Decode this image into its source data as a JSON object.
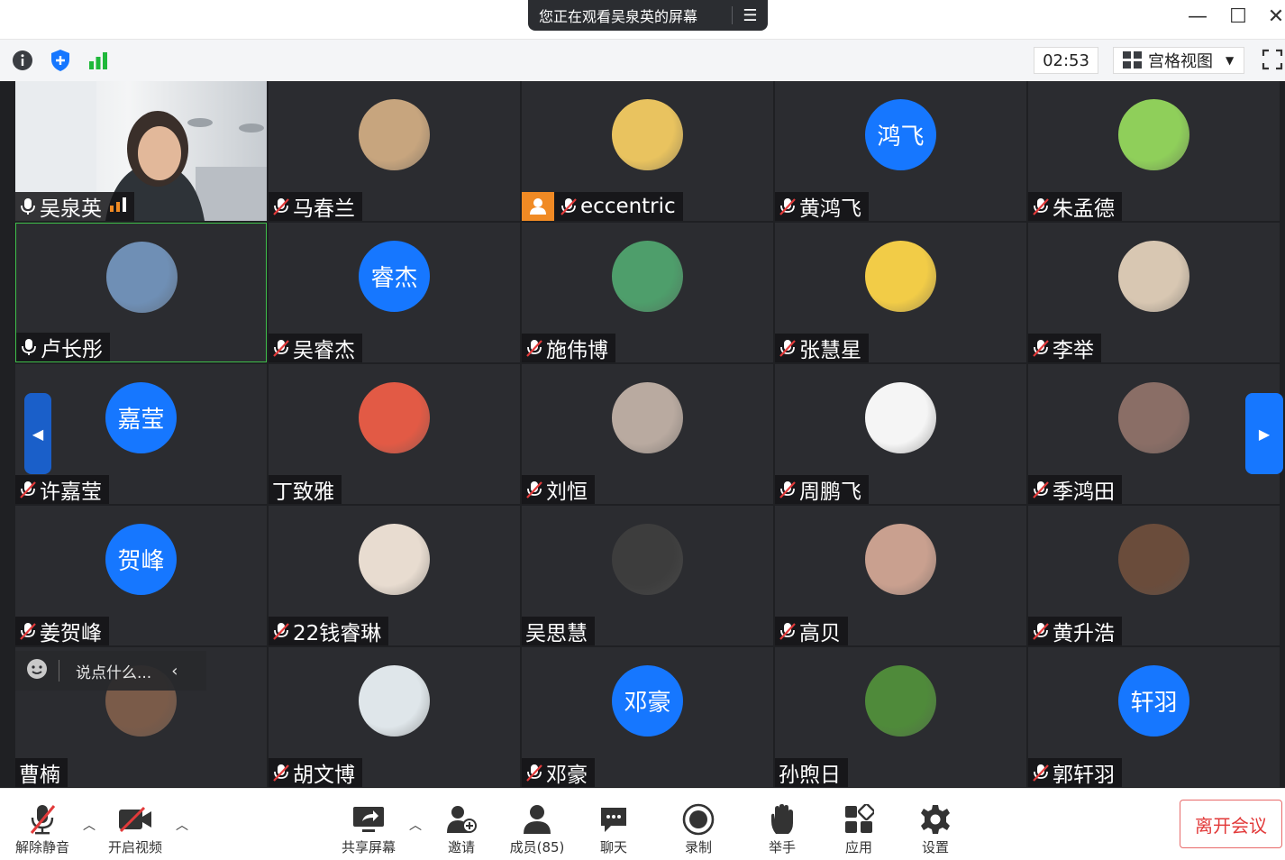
{
  "banner": {
    "text": "您正在观看吴泉英的屏幕",
    "menu_icon": "list-icon"
  },
  "window": {
    "minimize": "—",
    "maximize": "☐",
    "close": "✕"
  },
  "infobar": {
    "timer": "02:53",
    "view_mode": "宫格视图"
  },
  "chat": {
    "placeholder": "说点什么..."
  },
  "participants": [
    {
      "name": "吴泉英",
      "mic": "on",
      "type": "video"
    },
    {
      "name": "马春兰",
      "mic": "muted",
      "type": "photo",
      "bg": "#c7a57e"
    },
    {
      "name": "eccentric",
      "mic": "muted",
      "type": "photo",
      "bg": "#e9c35f",
      "badge": true
    },
    {
      "name": "黄鸿飞",
      "mic": "muted",
      "type": "text",
      "avatar_text": "鸿飞"
    },
    {
      "name": "朱孟德",
      "mic": "muted",
      "type": "photo",
      "bg": "#8fcf5a"
    },
    {
      "name": "卢长彤",
      "mic": "on",
      "type": "photo",
      "bg": "#6f8fb5",
      "active": true
    },
    {
      "name": "吴睿杰",
      "mic": "muted",
      "type": "text",
      "avatar_text": "睿杰"
    },
    {
      "name": "施伟博",
      "mic": "muted",
      "type": "photo",
      "bg": "#4e9e6b"
    },
    {
      "name": "张慧星",
      "mic": "muted",
      "type": "photo",
      "bg": "#f2cc47"
    },
    {
      "name": "李举",
      "mic": "muted",
      "type": "photo",
      "bg": "#d8c7b2"
    },
    {
      "name": "许嘉莹",
      "mic": "muted",
      "type": "text",
      "avatar_text": "嘉莹"
    },
    {
      "name": "丁致雅",
      "mic": "none",
      "type": "photo",
      "bg": "#e25a45"
    },
    {
      "name": "刘恒",
      "mic": "muted",
      "type": "photo",
      "bg": "#b9aaa0"
    },
    {
      "name": "周鹏飞",
      "mic": "muted",
      "type": "photo",
      "bg": "#f5f5f5"
    },
    {
      "name": "季鸿田",
      "mic": "muted",
      "type": "photo",
      "bg": "#8a6e66"
    },
    {
      "name": "姜贺峰",
      "mic": "muted",
      "type": "text",
      "avatar_text": "贺峰"
    },
    {
      "name": "22钱睿琳",
      "mic": "muted",
      "type": "photo",
      "bg": "#e8dcd0"
    },
    {
      "name": "吴思慧",
      "mic": "none",
      "type": "photo",
      "bg": "#3d3d3d"
    },
    {
      "name": "高贝",
      "mic": "muted",
      "type": "photo",
      "bg": "#c9a08f"
    },
    {
      "name": "黄升浩",
      "mic": "muted",
      "type": "photo",
      "bg": "#6a4c3b"
    },
    {
      "name": "曹楠",
      "mic": "none",
      "type": "photo",
      "bg": "#7a5b49"
    },
    {
      "name": "胡文博",
      "mic": "muted",
      "type": "photo",
      "bg": "#dfe6ea"
    },
    {
      "name": "邓豪",
      "mic": "muted",
      "type": "text",
      "avatar_text": "邓豪"
    },
    {
      "name": "孙煦日",
      "mic": "none",
      "type": "photo",
      "bg": "#4f8a3a"
    },
    {
      "name": "郭轩羽",
      "mic": "muted",
      "type": "text",
      "avatar_text": "轩羽"
    }
  ],
  "toolbar": {
    "unmute": "解除静音",
    "start_video": "开启视频",
    "share_screen": "共享屏幕",
    "invite": "邀请",
    "members": "成员(85)",
    "chat": "聊天",
    "record": "录制",
    "raise_hand": "举手",
    "apps": "应用",
    "settings": "设置",
    "leave": "离开会议"
  },
  "colors": {
    "accent_blue": "#1677ff",
    "active_green": "#3fbf4a",
    "leave_red": "#e23a3a",
    "recording_orange": "#f08a24"
  }
}
